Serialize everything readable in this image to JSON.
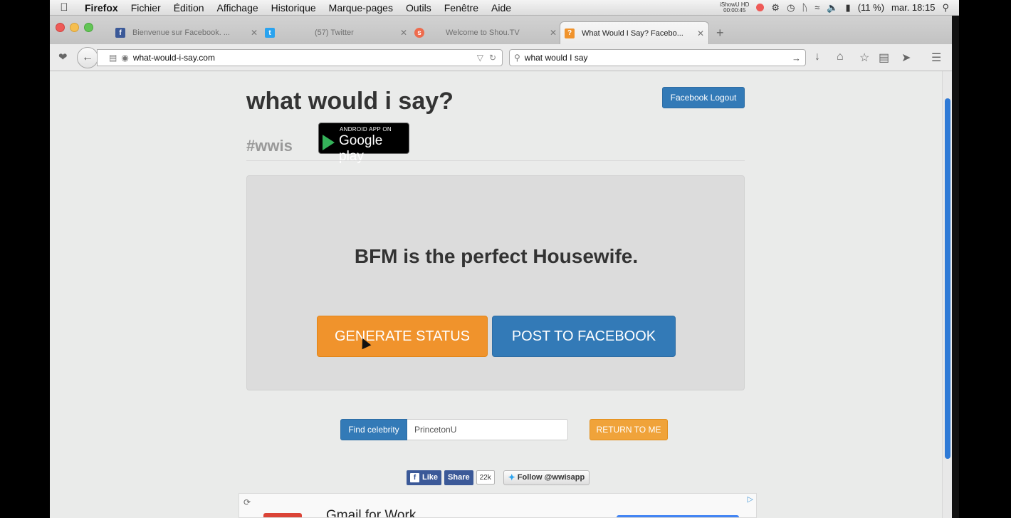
{
  "menubar": {
    "items": [
      "Firefox",
      "Fichier",
      "Édition",
      "Affichage",
      "Historique",
      "Marque-pages",
      "Outils",
      "Fenêtre",
      "Aide"
    ],
    "recorder": [
      "iShowU HD",
      "00:00:45"
    ],
    "battery": "(11 %)",
    "clock": "mar. 18:15"
  },
  "tabs": [
    {
      "title": "Bienvenue sur Facebook. ...",
      "favicon": "f",
      "color": "#3b5998"
    },
    {
      "title": "(57) Twitter",
      "favicon": "t",
      "color": "#2aa3ef"
    },
    {
      "title": "Welcome to Shou.TV",
      "favicon": "s",
      "color": "#ee6b4d"
    },
    {
      "title": "What Would I Say? Facebo...",
      "favicon": "?",
      "color": "#f0932c"
    }
  ],
  "navbar": {
    "url": "what-would-i-say.com",
    "search": "what would I say"
  },
  "page": {
    "brand": "what would i say?",
    "hashtag": "#wwis",
    "gplay_small": "ANDROID APP ON",
    "gplay_big": "Google play",
    "logout": "Facebook Logout",
    "status": "BFM is the perfect Housewife.",
    "generate": "GENERATE STATUS",
    "post": "POST TO FACEBOOK",
    "find_label": "Find celebrity",
    "find_value": "PrincetonU",
    "return": "RETURN TO ME",
    "like": "Like",
    "share": "Share",
    "share_count": "22k",
    "follow": "Follow @wwisapp",
    "ad_title": "Gmail for Work"
  }
}
